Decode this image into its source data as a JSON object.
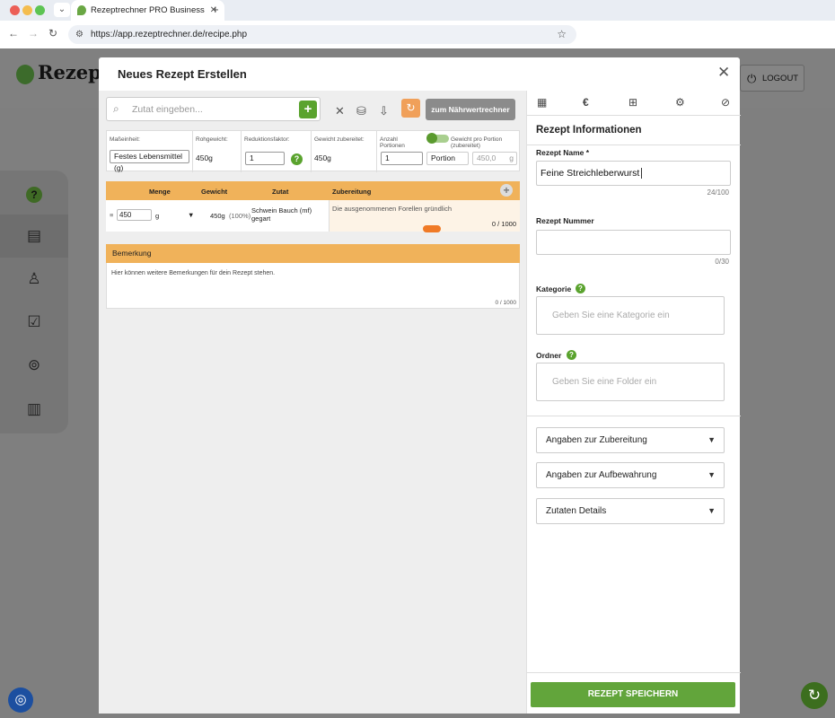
{
  "browser": {
    "tab_title": "Rezeptrechner PRO Business",
    "url": "https://app.rezeptrechner.de/recipe.php"
  },
  "app": {
    "logo_text": "Rezeptre",
    "logout_label": "LOGOUT"
  },
  "modal": {
    "title": "Neues Rezept Erstellen",
    "search_placeholder": "Zutat eingeben...",
    "calc_button": "zum Nährwertrechner",
    "props": {
      "unit_label": "Maßeinheit:",
      "unit_value": "Festes Lebensmittel (g)",
      "raw_label": "Rohgewicht:",
      "raw_value": "450g",
      "reduction_label": "Reduktionsfaktor:",
      "reduction_value": "1",
      "prepared_label": "Gewicht zubereitet:",
      "prepared_value": "450g",
      "portions_label": "Anzahl Portionen",
      "portions_value": "1",
      "portion_unit": "Portion",
      "per_portion_label": "Gewicht pro Portion (zubereitet)",
      "per_portion_value": "450,0",
      "per_portion_unit": "g"
    },
    "ingredients": {
      "headers": [
        "Menge",
        "Gewicht",
        "Zutat",
        "Zubereitung"
      ],
      "rows": [
        {
          "amount": "450",
          "unit": "g",
          "weight": "450g",
          "percent": "(100%)",
          "name": "Schwein Bauch (mf) gegart",
          "prep": "Die ausgenommenen Forellen gründlich",
          "prep_count": "0 / 1000"
        }
      ]
    },
    "remarks": {
      "header": "Bemerkung",
      "text": "Hier können weitere Bemerkungen für dein Rezept stehen.",
      "count": "0 / 1000"
    },
    "info": {
      "title": "Rezept Informationen",
      "name_label": "Rezept Name *",
      "name_value": "Feine Streichleberwurst",
      "name_count": "24/100",
      "number_label": "Rezept Nummer",
      "number_value": "",
      "number_count": "0/30",
      "category_label": "Kategorie",
      "category_placeholder": "Geben Sie eine Kategorie ein",
      "folder_label": "Ordner",
      "folder_placeholder": "Geben Sie eine Folder ein",
      "sections": [
        "Angaben zur Zubereitung",
        "Angaben zur Aufbewahrung",
        "Zutaten Details"
      ],
      "save_label": "REZEPT SPEICHERN"
    }
  }
}
